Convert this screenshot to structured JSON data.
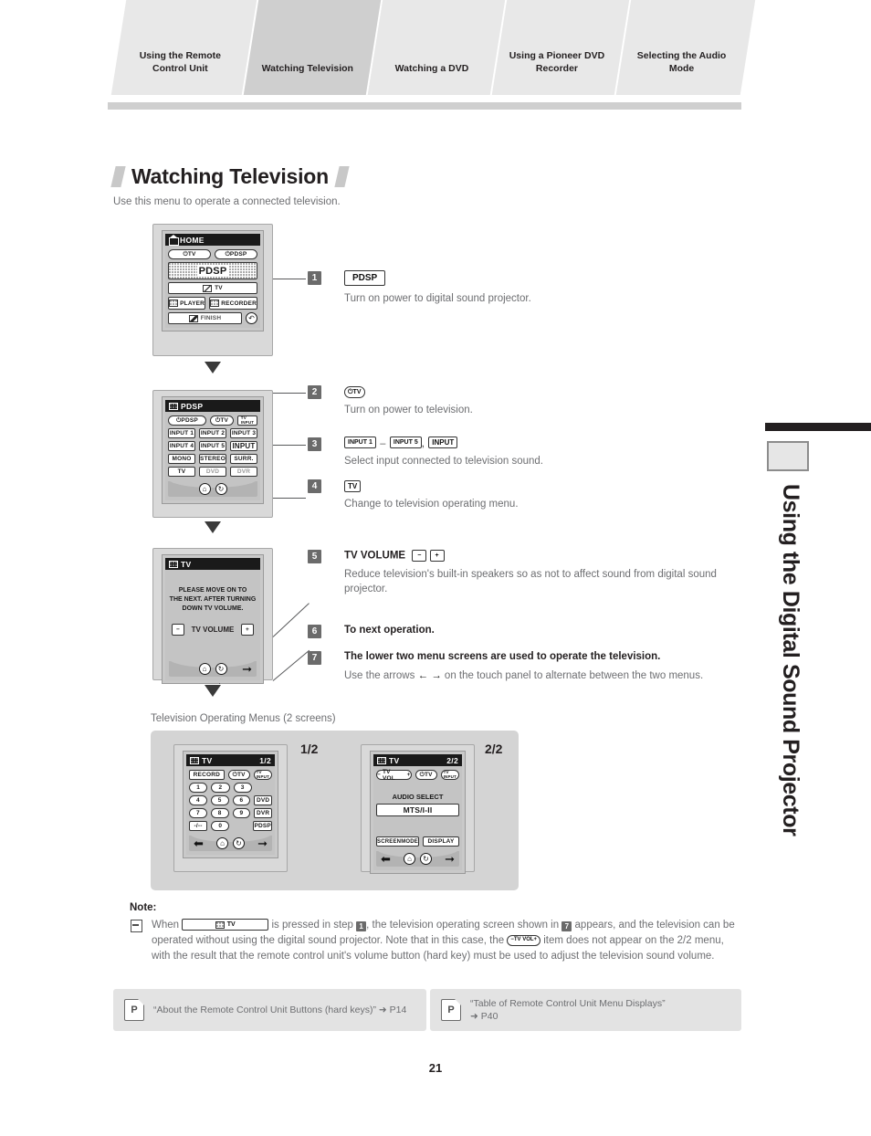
{
  "header": {
    "tabs": [
      {
        "label": "Using the Remote\nControl Unit",
        "active": false
      },
      {
        "label": "Watching Television",
        "active": true
      },
      {
        "label": "Watching a DVD",
        "active": false
      },
      {
        "label": "Using a Pioneer DVD\nRecorder",
        "active": false
      },
      {
        "label": "Selecting the Audio\nMode",
        "active": false
      }
    ]
  },
  "page": {
    "title": "Watching Television",
    "subtitle": "Use this menu to operate a connected television.",
    "number": "21"
  },
  "sidebar": {
    "text": "Using the Digital Sound Projector",
    "icon": "dotted-grid-icon"
  },
  "screen_home": {
    "title": "HOME",
    "title_icon": "home-icon",
    "buttons": {
      "tv_power": "TV",
      "pdsp_power": "PDSP",
      "pdsp_main": "PDSP",
      "tv": "TV",
      "player": "PLAYER",
      "recorder": "RECORDER",
      "finish": "FINISH",
      "back": "back-arrow-icon"
    }
  },
  "screen_pdsp": {
    "title": "PDSP",
    "buttons": {
      "pdsp_power": "PDSP",
      "tv_power": "TV",
      "tv_input": "TV\nINPUT",
      "input1": "INPUT 1",
      "input2": "INPUT 2",
      "input3": "INPUT 3",
      "input4": "INPUT 4",
      "input5": "INPUT 5",
      "input": "INPUT",
      "mono": "MONO",
      "stereo": "STEREO",
      "surr": "SURR.",
      "tv": "TV",
      "dvd": "DVD",
      "dvr": "DVR"
    }
  },
  "screen_tv": {
    "title": "TV",
    "message": "PLEASE MOVE ON TO\nTHE NEXT. AFTER TURNING\nDOWN TV VOLUME.",
    "volume_label": "TV VOLUME",
    "minus": "−",
    "plus": "+"
  },
  "menus": {
    "label": "Television Operating Menus (2 screens)",
    "page1_badge": "1/2",
    "page2_badge": "2/2",
    "screen1": {
      "title": "TV",
      "page": "1/2",
      "record": "RECORD",
      "tv_power": "TV",
      "tv_input": "TV\nINPUT",
      "keys": [
        "1",
        "2",
        "3",
        "4",
        "5",
        "6",
        "7",
        "8",
        "9",
        "-/--",
        "0"
      ],
      "dvd": "DVD",
      "dvr": "DVR",
      "pdsp": "PDSP"
    },
    "screen2": {
      "title": "TV",
      "page": "2/2",
      "tv_vol": "TV VOL",
      "tv_power": "TV",
      "tv_input": "TV\nINPUT",
      "audio_select_label": "AUDIO SELECT",
      "audio_select_value": "MTS/I-II",
      "screen_mode": "SCREENMODE",
      "display": "DISPLAY"
    }
  },
  "steps": [
    {
      "num": "1",
      "key": "PDSP",
      "head": "",
      "text": "Turn on power to digital sound projector."
    },
    {
      "num": "2",
      "key": "TV",
      "head": "",
      "text": "Turn on power to television."
    },
    {
      "num": "3",
      "key_a": "INPUT 1",
      "key_b": "INPUT 5",
      "key_c": "INPUT",
      "dash": "–",
      "comma": ",",
      "text": "Select input connected to television sound."
    },
    {
      "num": "4",
      "key": "TV",
      "text": "Change to television operating menu."
    },
    {
      "num": "5",
      "head": "TV VOLUME",
      "minus": "−",
      "plus": "+",
      "text": "Reduce television's built-in speakers so as not to affect sound from digital sound projector."
    },
    {
      "num": "6",
      "head": "To next operation.",
      "text": ""
    },
    {
      "num": "7",
      "head": "The lower two menu screens are used to operate the television.",
      "text_before": "Use the arrows ",
      "arrow_left": "←",
      "arrow_right": "→",
      "text_after": " on the touch panel to alternate between the two menus."
    }
  ],
  "note": {
    "heading": "Note:",
    "icon": "note-icon",
    "text_1": "When",
    "key_tv": "TV",
    "text_2": "is pressed in step",
    "step_a": "1",
    "text_3": ", the television operating screen shown in",
    "step_b": "7",
    "text_4": "appears, and the television can be operated without using the digital sound projector. Note that in this case, the",
    "key_tvvol": "TV VOL",
    "text_5": "item does not appear on the 2/2 menu, with the result that the remote control unit's volume button (hard key) must be used to adjust the television sound volume."
  },
  "references": [
    {
      "icon": "page-reference-icon",
      "text": "“About the Remote Control Unit Buttons (hard keys)”",
      "arrow": "➜",
      "page": "P14"
    },
    {
      "icon": "page-reference-icon",
      "text": "“Table of Remote Control Unit Menu Displays”",
      "arrow": "➜",
      "page": "P40"
    }
  ],
  "colors": {
    "tab_active": "#cfcfcf",
    "tab_inactive": "#e8e8e8",
    "body_text": "#6d6e71",
    "heading": "#231f20",
    "step_badge": "#6b6b6b"
  }
}
